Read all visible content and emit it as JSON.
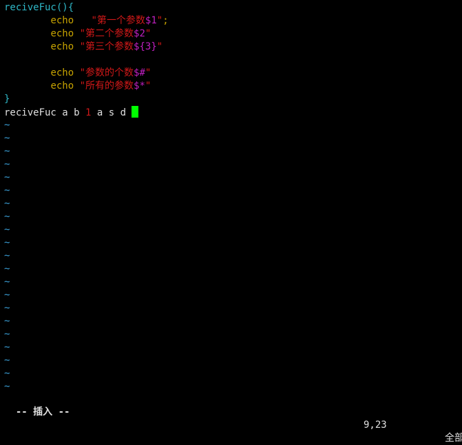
{
  "editor": {
    "lines": {
      "l1": {
        "name": "reciveFuc",
        "parens": "()",
        "brace": "{"
      },
      "l2": {
        "indent": "        ",
        "cmd": "echo",
        "gap": "   ",
        "q1": "\"",
        "text": "第一个参数",
        "var": "$1",
        "q2": "\"",
        "semi": ";"
      },
      "l3": {
        "indent": "        ",
        "cmd": "echo",
        "gap": " ",
        "q1": "\"",
        "text": "第二个参数",
        "var": "$2",
        "q2": "\""
      },
      "l4": {
        "indent": "        ",
        "cmd": "echo",
        "gap": " ",
        "q1": "\"",
        "text": "第三个参数",
        "var": "${3}",
        "q2": "\""
      },
      "l6": {
        "indent": "        ",
        "cmd": "echo",
        "gap": " ",
        "q1": "\"",
        "text": "参数的个数",
        "var": "$#",
        "q2": "\""
      },
      "l7": {
        "indent": "        ",
        "cmd": "echo",
        "gap": " ",
        "q1": "\"",
        "text": "所有的参数",
        "var": "$*",
        "q2": "\""
      },
      "l8": {
        "brace": "}"
      },
      "l9": {
        "call": "reciveFuc a b ",
        "num": "1",
        "rest": " a s d "
      }
    },
    "tilde": "~",
    "empty_line_markers": 21
  },
  "statusline": {
    "mode": "-- 插入 --",
    "position": "9,23",
    "scroll": "全部"
  },
  "colors": {
    "background": "#000000",
    "keyword": "#2fb8c8",
    "command": "#c8a400",
    "string": "#d01818",
    "variable": "#c020c0",
    "tilde": "#3aa0d8",
    "cursor": "#00ff00"
  }
}
